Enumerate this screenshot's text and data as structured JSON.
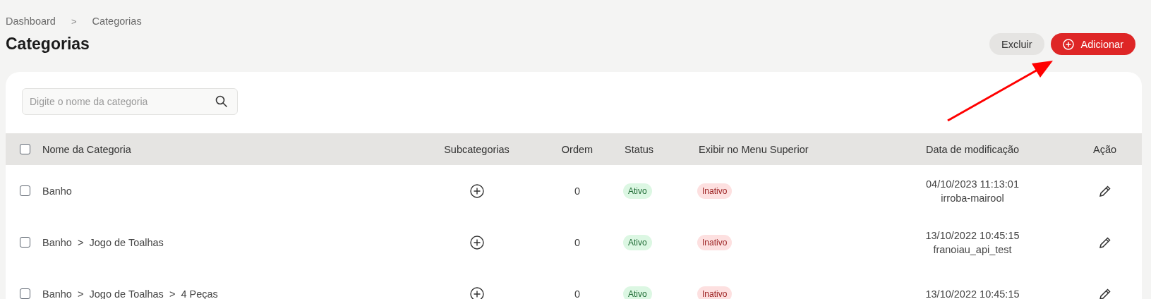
{
  "breadcrumb": [
    {
      "label": "Dashboard"
    },
    {
      "label": "Categorias"
    }
  ],
  "breadcrumb_separator": ">",
  "title": "Categorias",
  "actions": [
    {
      "label": "Excluir",
      "kind": "secondary"
    },
    {
      "label": "Adicionar",
      "kind": "primary"
    }
  ],
  "search": {
    "placeholder": "Digite o nome da categoria"
  },
  "table": {
    "select_all": {
      "checked": false
    },
    "columns": [
      "Nome da Categoria",
      "Subcategorias",
      "Ordem",
      "Status",
      "Exibir no Menu Superior",
      "Data de modificação",
      "Ação"
    ],
    "rows": [
      {
        "checked": false,
        "path": [
          "Banho"
        ],
        "order": "0",
        "status": {
          "label": "Ativo",
          "active": true
        },
        "menu": {
          "label": "Inativo",
          "active": false
        },
        "date": "04/10/2023 11:13:01",
        "user": "irroba-mairool"
      },
      {
        "checked": false,
        "path": [
          "Banho",
          "Jogo de Toalhas"
        ],
        "order": "0",
        "status": {
          "label": "Ativo",
          "active": true
        },
        "menu": {
          "label": "Inativo",
          "active": false
        },
        "date": "13/10/2022 10:45:15",
        "user": "franoiau_api_test"
      },
      {
        "checked": false,
        "path": [
          "Banho",
          "Jogo de Toalhas",
          "4 Peças"
        ],
        "order": "0",
        "status": {
          "label": "Ativo",
          "active": true
        },
        "menu": {
          "label": "Inativo",
          "active": false
        },
        "date": "13/10/2022 10:45:15"
      }
    ]
  },
  "path_separator": ">"
}
